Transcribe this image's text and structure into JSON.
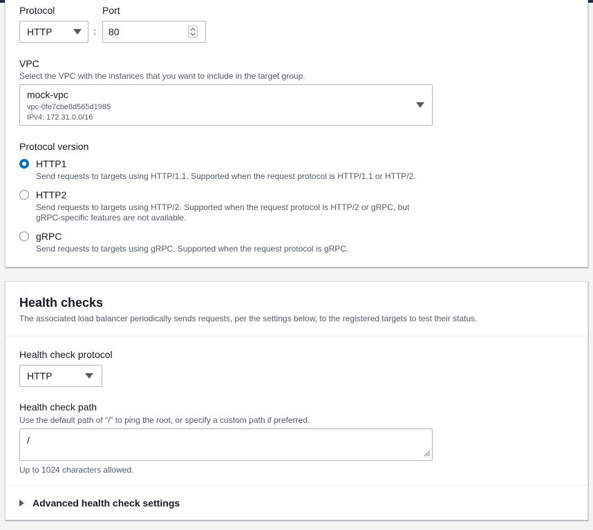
{
  "target_settings": {
    "protocol_label": "Protocol",
    "protocol_value": "HTTP",
    "port_label": "Port",
    "port_separator": ":",
    "port_value": "80",
    "vpc_label": "VPC",
    "vpc_description": "Select the VPC with the instances that you want to include in the target group.",
    "vpc_name": "mock-vpc",
    "vpc_id": "vpc-0fe7cbe8d565d1985",
    "vpc_cidr": "IPv4: 172.31.0.0/16",
    "protocol_version_label": "Protocol version",
    "protocol_versions": [
      {
        "label": "HTTP1",
        "description": "Send requests to targets using HTTP/1.1. Supported when the request protocol is HTTP/1.1 or HTTP/2.",
        "description_line2": "",
        "selected": true
      },
      {
        "label": "HTTP2",
        "description": "Send requests to targets using HTTP/2. Supported when the request protocol is HTTP/2 or gRPC, but",
        "description_line2": "gRPC-specific features are not available.",
        "selected": false
      },
      {
        "label": "gRPC",
        "description": "Send requests to targets using gRPC. Supported when the request protocol is gRPC.",
        "description_line2": "",
        "selected": false
      }
    ]
  },
  "health_checks": {
    "title": "Health checks",
    "description": "The associated load balancer periodically sends requests, per the settings below, to the registered targets to test their status.",
    "protocol_label": "Health check protocol",
    "protocol_value": "HTTP",
    "path_label": "Health check path",
    "path_description": "Use the default path of “/” to ping the root, or specify a custom path if preferred.",
    "path_value": "/",
    "path_constraint": "Up to 1024 characters allowed.",
    "advanced_label": "Advanced health check settings"
  },
  "colors": {
    "accent": "#0073bb",
    "text": "#16191f",
    "secondary_text": "#545b64",
    "border": "#aab7b8",
    "background": "#f2f3f3"
  },
  "icons": {
    "dropdown": "caret-down-icon",
    "stepper": "updown-stepper-icon",
    "expander": "caret-right-icon",
    "resize": "resize-grip-icon"
  }
}
